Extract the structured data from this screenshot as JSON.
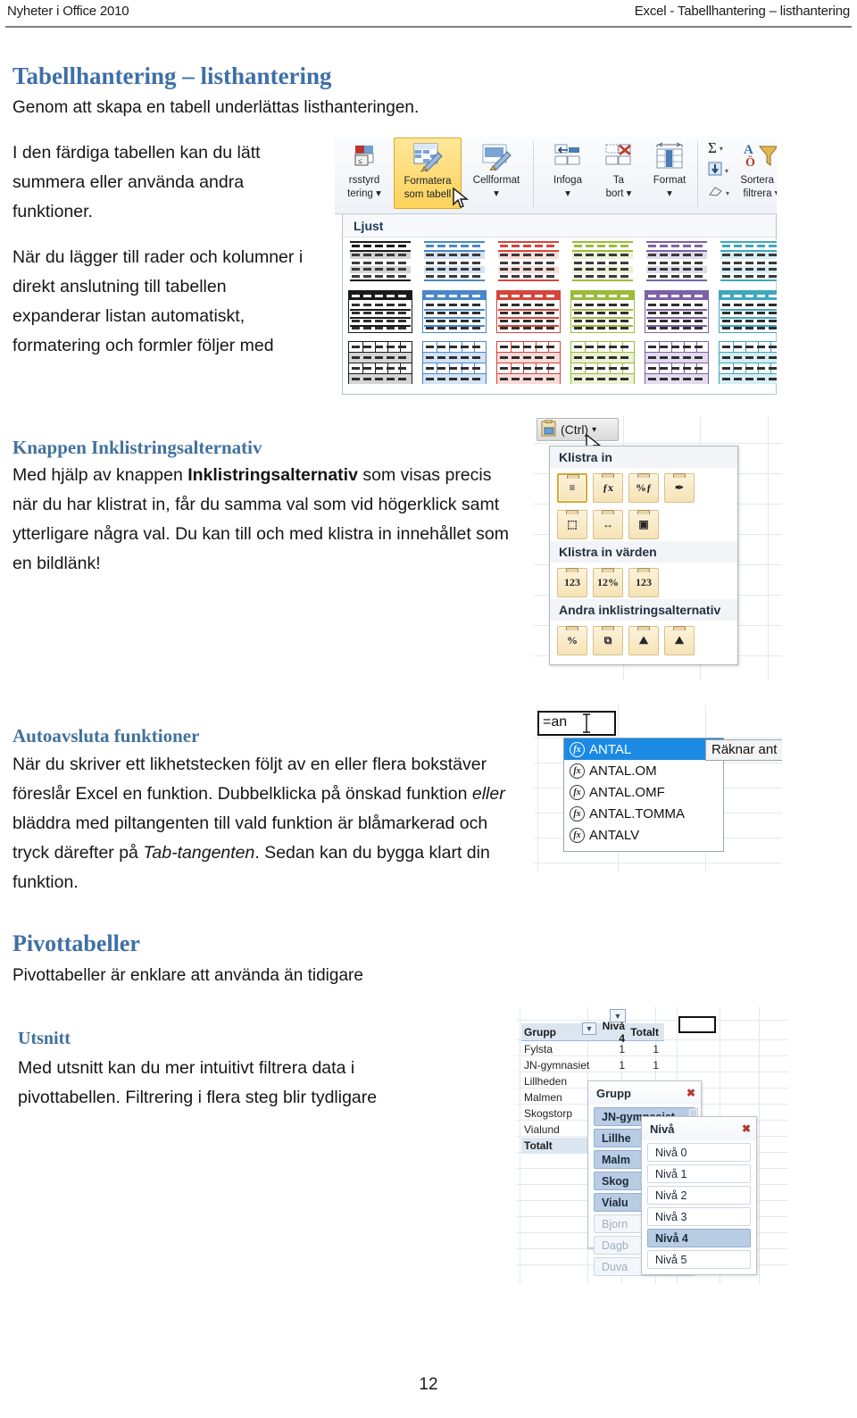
{
  "header": {
    "left": "Nyheter i Office 2010",
    "right": "Excel - Tabellhantering – listhantering"
  },
  "page_number": "12",
  "sections": {
    "title": "Tabellhantering – listhantering",
    "subtitle": "Genom att skapa en tabell underlättas listhanteringen.",
    "para1": "I den färdiga tabellen kan du lätt summera eller använda andra funktioner.",
    "para2": "När du lägger till rader och kolumner i direkt anslutning till tabellen expanderar listan automatiskt, formatering och formler följer med",
    "paste_heading": "Knappen Inklistringsalternativ",
    "paste_body_1": "Med hjälp av knappen ",
    "paste_body_bold": "Inklistringsalternativ",
    "paste_body_2": " som visas precis när du har klistrat in, får du samma val som vid högerklick samt ytterligare några val. Du kan till och med klistra in innehållet som en bildlänk!",
    "auto_heading": "Autoavsluta funktioner",
    "auto_body_1": "När du skriver ett likhetstecken följt av en eller flera bokstäver föreslår Excel en funktion. Dubbelklicka på önskad funktion ",
    "auto_body_i1": "eller",
    "auto_body_2": " bläddra med piltangenten till vald funktion är blåmarkerad och tryck därefter på ",
    "auto_body_i2": "Tab-tangenten",
    "auto_body_3": ". Sedan kan du bygga klart din funktion.",
    "pivot_heading": "Pivottabeller",
    "pivot_body": "Pivottabeller är enklare att använda än tidigare",
    "utsnitt_heading": "Utsnitt",
    "utsnitt_body": "Med utsnitt kan du mer intuitivt filtrera data i pivottabellen.  Filtrering i flera steg blir tydligare"
  },
  "ribbon_shot": {
    "buttons": [
      {
        "label_line1": "rsstyrd",
        "label_line2": "tering ▾",
        "highlight": false
      },
      {
        "label_line1": "Formatera",
        "label_line2": "som tabell",
        "highlight": true
      },
      {
        "label_line1": "Cellformat",
        "label_line2": "▾",
        "highlight": false
      },
      {
        "label_line1": "Infoga",
        "label_line2": "▾",
        "highlight": false
      },
      {
        "label_line1": "Ta",
        "label_line2": "bort ▾",
        "highlight": false
      },
      {
        "label_line1": "Format",
        "label_line2": "▾",
        "highlight": false
      },
      {
        "label_line1": "Sortera o",
        "label_line2": "filtrera ▾",
        "highlight": false
      }
    ],
    "sum_glyph": "Σ",
    "gallery_title": "Ljust",
    "gallery_colors": [
      "#1a1a1a",
      "#4a87c8",
      "#d6453c",
      "#9bbb3a",
      "#7d61a8",
      "#3fa7bd"
    ],
    "gallery_tints": [
      "#d4d4d4",
      "#d3e3f4",
      "#fadbd8",
      "#eaf2d4",
      "#e2dbee",
      "#d6eff4"
    ],
    "gallery_rows": 3,
    "gallery_cols": 6
  },
  "paste_shot": {
    "button_label": "(Ctrl)",
    "button_chevron": "▾",
    "groups": [
      {
        "title": "Klistra in",
        "rows": [
          [
            "≡",
            "ƒx",
            "%ƒ",
            "✒"
          ],
          [
            "⬚",
            "↔",
            "▣"
          ]
        ]
      },
      {
        "title": "Klistra in värden",
        "rows": [
          [
            "123",
            "12%",
            "123"
          ]
        ]
      },
      {
        "title": "Andra inklistringsalternativ",
        "rows": [
          [
            "%",
            "⧉",
            "⛰",
            "⛰"
          ]
        ]
      }
    ]
  },
  "autocomplete_shot": {
    "cell_value": "=an",
    "items": [
      "ANTAL",
      "ANTAL.OM",
      "ANTAL.OMF",
      "ANTAL.TOMMA",
      "ANTALV"
    ],
    "selected_index": 0,
    "fx_label": "fx",
    "tooltip": "Räknar ant"
  },
  "pivot_shot": {
    "headers": [
      "Grupp",
      "Nivå 4",
      "Totalt"
    ],
    "rows": [
      {
        "name": "Fylsta",
        "v1": "1",
        "v2": "1"
      },
      {
        "name": "JN-gymnasiet",
        "v1": "1",
        "v2": "1"
      },
      {
        "name": "Lillheden",
        "v1": "",
        "v2": ""
      },
      {
        "name": "Malmen",
        "v1": "",
        "v2": ""
      },
      {
        "name": "Skogstorp",
        "v1": "",
        "v2": ""
      },
      {
        "name": "Vialund",
        "v1": "",
        "v2": ""
      },
      {
        "name": "Totalt",
        "v1": "",
        "v2": ""
      }
    ],
    "slicer_grupp": {
      "title": "Grupp",
      "items": [
        {
          "label": "JN-gymnasiet",
          "state": "on"
        },
        {
          "label": "Lillhe",
          "state": "on"
        },
        {
          "label": "Malm",
          "state": "on"
        },
        {
          "label": "Skog",
          "state": "on"
        },
        {
          "label": "Vialu",
          "state": "on"
        },
        {
          "label": "Bjorn",
          "state": "off"
        },
        {
          "label": "Dagb",
          "state": "off"
        },
        {
          "label": "Duva",
          "state": "off"
        }
      ]
    },
    "slicer_niva": {
      "title": "Nivå",
      "items": [
        {
          "label": "Nivå 0",
          "state": "plain"
        },
        {
          "label": "Nivå 1",
          "state": "plain"
        },
        {
          "label": "Nivå 2",
          "state": "plain"
        },
        {
          "label": "Nivå 3",
          "state": "plain"
        },
        {
          "label": "Nivå 4",
          "state": "on"
        },
        {
          "label": "Nivå 5",
          "state": "plain"
        }
      ]
    },
    "clear_filter_glyph": "✖"
  },
  "colors": {
    "heading_blue": "#3e6fa8",
    "subheading_blue": "#41719c",
    "highlight_yellow": "#fdd25a",
    "selection_blue": "#1a8ae5",
    "slicer_selected": "#b8cce4"
  }
}
